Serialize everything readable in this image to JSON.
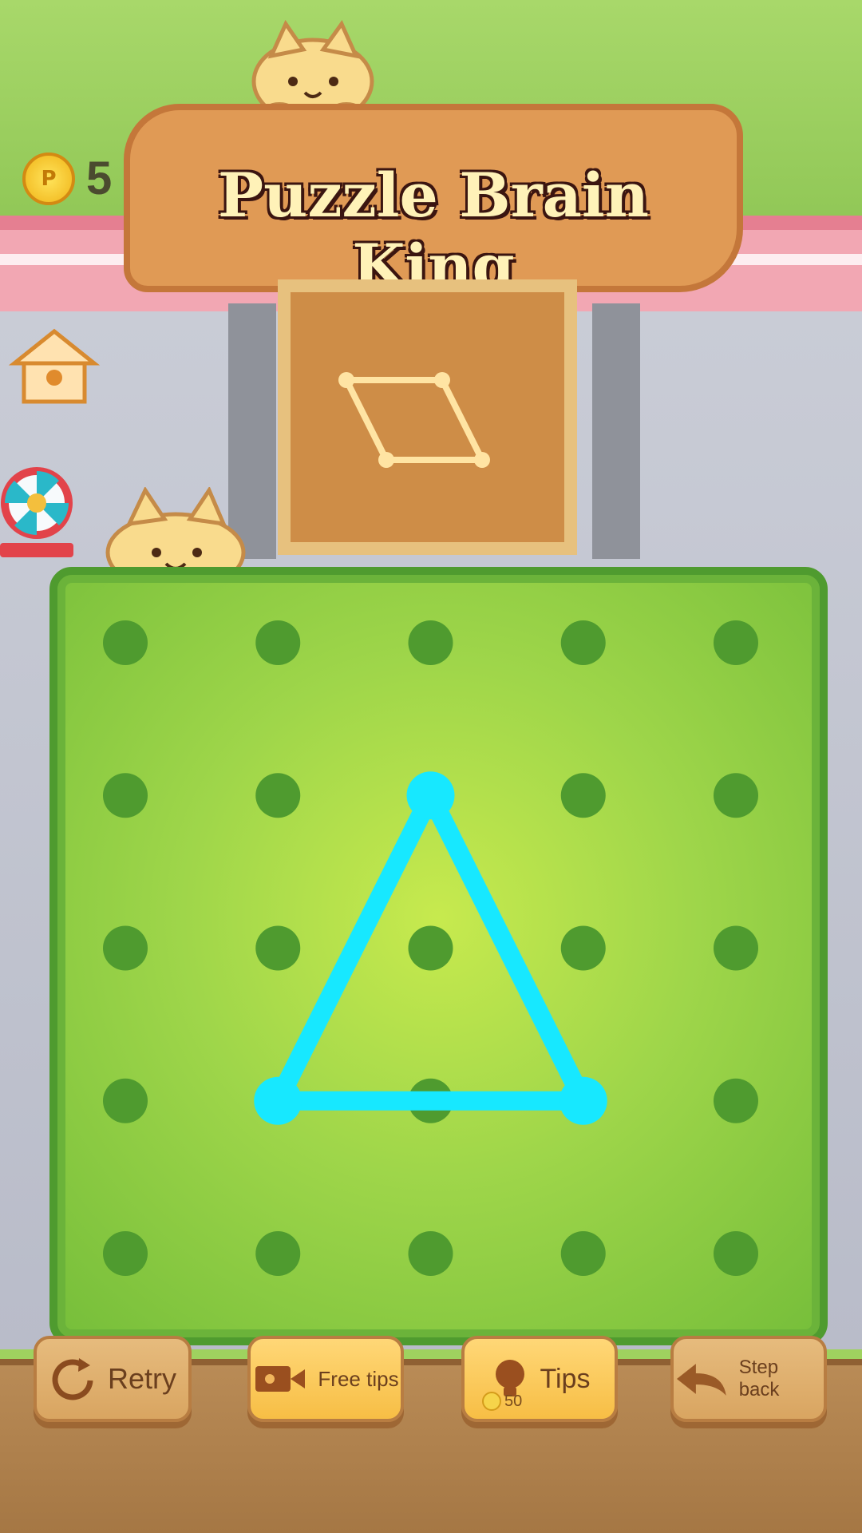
{
  "app": {
    "title": "Puzzle Brain King"
  },
  "hud": {
    "coin_label": "5"
  },
  "target_shape": {
    "shape": "parallelogram"
  },
  "board": {
    "grid_size": 5,
    "selected_points": [
      [
        2,
        1
      ],
      [
        1,
        3
      ],
      [
        3,
        3
      ]
    ]
  },
  "buttons": {
    "retry": "Retry",
    "free_tips": "Free tips",
    "tips": "Tips",
    "tips_cost": "50",
    "step_back": "Step back"
  },
  "icons": {
    "coin": "coin-icon",
    "retry": "retry-icon",
    "video": "video-icon",
    "bulb": "bulb-icon",
    "back": "back-arrow-icon",
    "house": "house-icon",
    "wheel": "wheel-icon"
  },
  "colors": {
    "selection": "#17e8ff",
    "dot": "#4f9b2f",
    "button_yellow": "#f7be45",
    "button_brown": "#d9a561"
  }
}
